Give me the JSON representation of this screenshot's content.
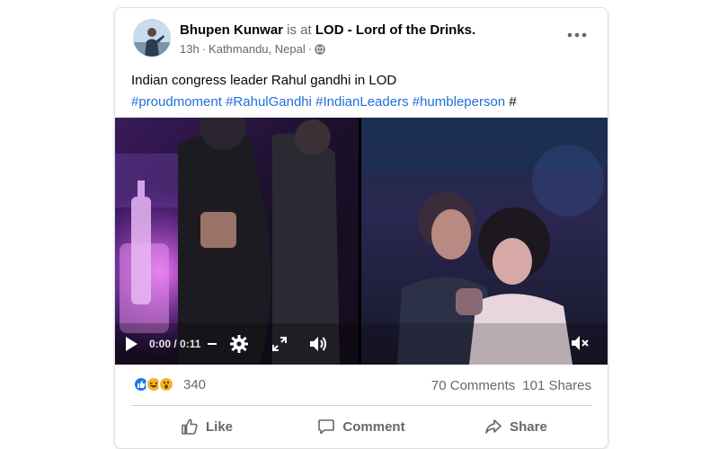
{
  "post": {
    "author": "Bhupen Kunwar",
    "connector": " is at ",
    "place": "LOD - Lord of the Drinks.",
    "time": "13h",
    "separator": " · ",
    "location": "Kathmandu, Nepal",
    "location_suffix": " · ",
    "text_line1": "Indian congress leader Rahul gandhi in LOD",
    "hashtags": [
      "#proudmoment",
      "#RahulGandhi",
      "#IndianLeaders",
      "#humbleperson",
      "#"
    ]
  },
  "video": {
    "time_display": "0:00 / 0:11"
  },
  "stats": {
    "reaction_count": "340",
    "comments": "70 Comments",
    "shares": "101 Shares"
  },
  "actions": {
    "like": "Like",
    "comment": "Comment",
    "share": "Share"
  },
  "colors": {
    "link": "#216fdb",
    "secondary_text": "#65676b",
    "like_blue": "#1877f2",
    "haha_yellow": "#f7b125"
  },
  "icons": [
    "globe-icon",
    "more-icon",
    "play-icon",
    "settings-icon",
    "fullscreen-icon",
    "volume-icon",
    "mute-icon",
    "like-reaction-icon",
    "haha-reaction-icon",
    "wow-reaction-icon",
    "like-icon",
    "comment-icon",
    "share-icon"
  ]
}
